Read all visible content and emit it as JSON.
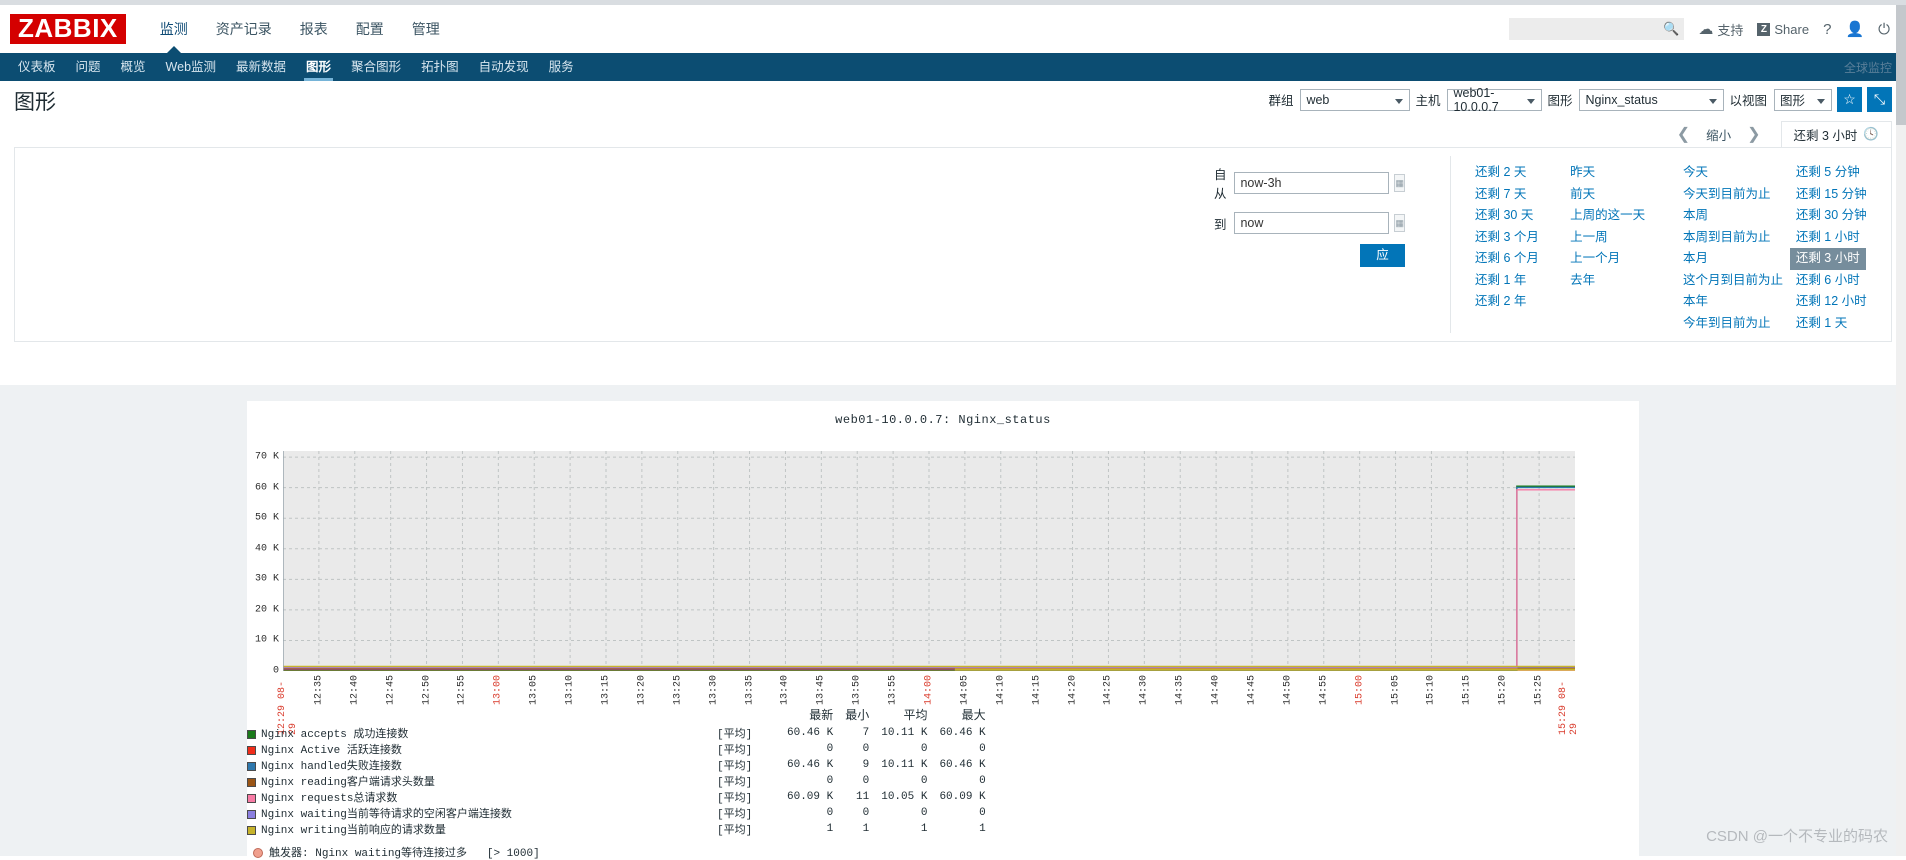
{
  "header": {
    "logo": "ZABBIX",
    "nav": [
      {
        "label": "监测",
        "selected": true
      },
      {
        "label": "资产记录",
        "selected": false
      },
      {
        "label": "报表",
        "selected": false
      },
      {
        "label": "配置",
        "selected": false
      },
      {
        "label": "管理",
        "selected": false
      }
    ],
    "search_placeholder": "",
    "search_value": "",
    "support_label": "支持",
    "share_label": "Share",
    "share_badge": "Z",
    "help_label": "?",
    "user_icon": "user-icon",
    "power_icon": "power-icon",
    "search_icon": "search-icon",
    "headset_icon": "headset-icon"
  },
  "subnav": {
    "items": [
      {
        "label": "仪表板",
        "selected": false
      },
      {
        "label": "问题",
        "selected": false
      },
      {
        "label": "概览",
        "selected": false
      },
      {
        "label": "Web监测",
        "selected": false
      },
      {
        "label": "最新数据",
        "selected": false
      },
      {
        "label": "图形",
        "selected": true
      },
      {
        "label": "聚合图形",
        "selected": false
      },
      {
        "label": "拓扑图",
        "selected": false
      },
      {
        "label": "自动发现",
        "selected": false
      },
      {
        "label": "服务",
        "selected": false
      }
    ],
    "right_label": "全球监控"
  },
  "page": {
    "title": "图形",
    "filters": {
      "group_label": "群组",
      "group_value": "web",
      "host_label": "主机",
      "host_value": "web01-10.0.0.7",
      "graph_label": "图形",
      "graph_value": "Nginx_status",
      "view_label": "以视图",
      "view_value": "图形",
      "favorite_icon": "star-icon",
      "fullscreen_icon": "expand-icon"
    }
  },
  "timenav": {
    "prev_icon": "chevron-left-icon",
    "zoom_label": "缩小",
    "next_icon": "chevron-right-icon",
    "current_range": "还剩 3 小时",
    "clock_icon": "clock-icon"
  },
  "timepanel": {
    "from_label": "自从",
    "from_value": "now-3h",
    "to_label": "到",
    "to_value": "now",
    "apply_label": "应用",
    "calendar_icon": "calendar-icon",
    "columns": [
      {
        "items": [
          {
            "label": "还剩 2 天",
            "active": false
          },
          {
            "label": "还剩 7 天",
            "active": false
          },
          {
            "label": "还剩 30 天",
            "active": false
          },
          {
            "label": "还剩 3 个月",
            "active": false
          },
          {
            "label": "还剩 6 个月",
            "active": false
          },
          {
            "label": "还剩 1 年",
            "active": false
          },
          {
            "label": "还剩 2 年",
            "active": false
          }
        ]
      },
      {
        "items": [
          {
            "label": "昨天",
            "active": false
          },
          {
            "label": "前天",
            "active": false
          },
          {
            "label": "上周的这一天",
            "active": false
          },
          {
            "label": "上一周",
            "active": false
          },
          {
            "label": "上一个月",
            "active": false
          },
          {
            "label": "去年",
            "active": false
          }
        ]
      },
      {
        "items": [
          {
            "label": "今天",
            "active": false
          },
          {
            "label": "今天到目前为止",
            "active": false
          },
          {
            "label": "本周",
            "active": false
          },
          {
            "label": "本周到目前为止",
            "active": false
          },
          {
            "label": "本月",
            "active": false
          },
          {
            "label": "这个月到目前为止",
            "active": false
          },
          {
            "label": "本年",
            "active": false
          },
          {
            "label": "今年到目前为止",
            "active": false
          }
        ]
      },
      {
        "items": [
          {
            "label": "还剩 5 分钟",
            "active": false
          },
          {
            "label": "还剩 15 分钟",
            "active": false
          },
          {
            "label": "还剩 30 分钟",
            "active": false
          },
          {
            "label": "还剩 1 小时",
            "active": false
          },
          {
            "label": "还剩 3 小时",
            "active": true
          },
          {
            "label": "还剩 6 小时",
            "active": false
          },
          {
            "label": "还剩 12 小时",
            "active": false
          },
          {
            "label": "还剩 1 天",
            "active": false
          }
        ]
      }
    ]
  },
  "chart_data": {
    "type": "line",
    "title": "web01-10.0.0.7: Nginx_status",
    "xlabel": "",
    "ylabel": "",
    "ylim": [
      0,
      72000
    ],
    "yticks": [
      0,
      10000,
      20000,
      30000,
      40000,
      50000,
      60000,
      70000
    ],
    "ytick_labels": [
      "0",
      "10 K",
      "20 K",
      "30 K",
      "40 K",
      "50 K",
      "60 K",
      "70 K"
    ],
    "grid": true,
    "x_start_label": "08-29 12:29",
    "x_end_label": "08-29 15:29",
    "xtick_labels": [
      "12:29",
      "12:35",
      "12:40",
      "12:45",
      "12:50",
      "12:55",
      "13:00",
      "13:05",
      "13:10",
      "13:15",
      "13:20",
      "13:25",
      "13:30",
      "13:35",
      "13:40",
      "13:45",
      "13:50",
      "13:55",
      "14:00",
      "14:05",
      "14:10",
      "14:15",
      "14:20",
      "14:25",
      "14:30",
      "14:35",
      "14:40",
      "14:45",
      "14:50",
      "14:55",
      "15:00",
      "15:05",
      "15:10",
      "15:15",
      "15:20",
      "15:25",
      "15:29"
    ],
    "xtick_highlight": [
      "12:29",
      "13:00",
      "14:00",
      "15:00",
      "15:29"
    ],
    "series": [
      {
        "name": "Nginx  accepts 成功连接数",
        "color": "#1a7a1a",
        "last": 60460,
        "min": 7,
        "avg": 10110,
        "max": 60460,
        "spike_at": "15:21"
      },
      {
        "name": "Nginx  Active 活跃连接数",
        "color": "#f02d1a",
        "last": 0,
        "min": 0,
        "avg": 0,
        "max": 0
      },
      {
        "name": "Nginx  handled失败连接数",
        "color": "#2e78ad",
        "last": 60460,
        "min": 9,
        "avg": 10110,
        "max": 60460,
        "spike_at": "15:21"
      },
      {
        "name": "Nginx  reading客户端请求头数量",
        "color": "#9a5515",
        "last": 0,
        "min": 0,
        "avg": 0,
        "max": 0
      },
      {
        "name": "Nginx  requests总请求数",
        "color": "#f87ba5",
        "last": 60090,
        "min": 11,
        "avg": 10050,
        "max": 60090,
        "spike_at": "15:21"
      },
      {
        "name": "Nginx  waiting当前等待请求的空闲客户端连接数",
        "color": "#8b7fe0",
        "last": 0,
        "min": 0,
        "avg": 0,
        "max": 0
      },
      {
        "name": "Nginx  writing当前响应的请求数量",
        "color": "#c6b32b",
        "last": 1,
        "min": 1,
        "avg": 1,
        "max": 1
      }
    ],
    "legend_headers": [
      "最新",
      "最小",
      "平均",
      "最大"
    ],
    "legend_aggregate": "[平均]",
    "legend_rows": [
      {
        "swatch": "#1a7a1a",
        "name": "Nginx  accepts 成功连接数",
        "agg": "[平均]",
        "last": "60.46 K",
        "min": "7",
        "avg": "10.11 K",
        "max": "60.46 K"
      },
      {
        "swatch": "#f02d1a",
        "name": "Nginx  Active 活跃连接数",
        "agg": "[平均]",
        "last": "0",
        "min": "0",
        "avg": "0",
        "max": "0"
      },
      {
        "swatch": "#2e78ad",
        "name": "Nginx  handled失败连接数",
        "agg": "[平均]",
        "last": "60.46 K",
        "min": "9",
        "avg": "10.11 K",
        "max": "60.46 K"
      },
      {
        "swatch": "#9a5515",
        "name": "Nginx  reading客户端请求头数量",
        "agg": "[平均]",
        "last": "0",
        "min": "0",
        "avg": "0",
        "max": "0"
      },
      {
        "swatch": "#f87ba5",
        "name": "Nginx  requests总请求数",
        "agg": "[平均]",
        "last": "60.09 K",
        "min": "11",
        "avg": "10.05 K",
        "max": "60.09 K"
      },
      {
        "swatch": "#8b7fe0",
        "name": "Nginx  waiting当前等待请求的空闲客户端连接数",
        "agg": "[平均]",
        "last": "0",
        "min": "0",
        "avg": "0",
        "max": "0"
      },
      {
        "swatch": "#c6b32b",
        "name": "Nginx  writing当前响应的请求数量",
        "agg": "[平均]",
        "last": "1",
        "min": "1",
        "avg": "1",
        "max": "1"
      }
    ],
    "trigger": {
      "label": "触发器:",
      "text": "Nginx waiting等待连接过多",
      "threshold": "[> 1000]",
      "color": "#f0a08e"
    }
  },
  "watermark": "CSDN @一个不专业的码农"
}
